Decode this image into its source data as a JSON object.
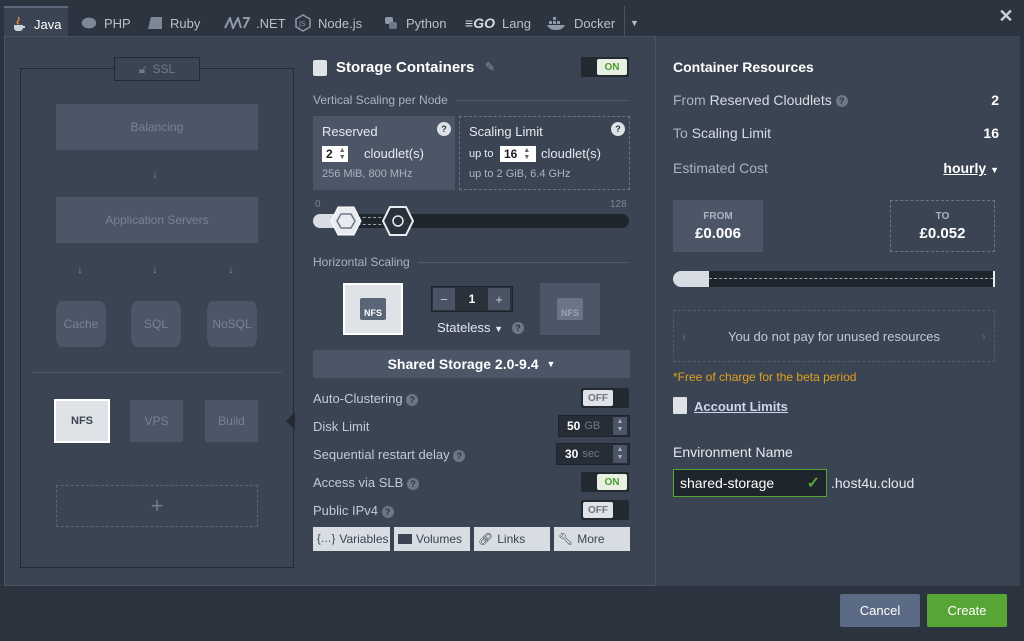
{
  "tabs": [
    {
      "label": "Java",
      "icon": "java-icon"
    },
    {
      "label": "PHP",
      "icon": "php-icon"
    },
    {
      "label": "Ruby",
      "icon": "ruby-icon"
    },
    {
      "label": ".NET",
      "icon": "dotnet-icon"
    },
    {
      "label": "Node.js",
      "icon": "nodejs-icon"
    },
    {
      "label": "Python",
      "icon": "python-icon"
    },
    {
      "label": "Lang",
      "icon": "go-icon",
      "prefix": "GO"
    },
    {
      "label": "Docker",
      "icon": "docker-icon"
    }
  ],
  "topology": {
    "ssl": "SSL",
    "balancing": "Balancing",
    "app_servers": "Application Servers",
    "cache": "Cache",
    "sql": "SQL",
    "nosql": "NoSQL",
    "nfs": "NFS",
    "vps": "VPS",
    "build": "Build",
    "add": "+"
  },
  "storage": {
    "title": "Storage Containers",
    "toggle": "ON",
    "vertical_scaling": "Vertical Scaling per Node",
    "reserved_label": "Reserved",
    "reserved_value": "2",
    "cloudlets": "cloudlet(s)",
    "reserved_spec": "256 MiB, 800 MHz",
    "limit_label": "Scaling Limit",
    "up_to": "up to",
    "limit_value": "16",
    "limit_spec": "up to 2 GiB, 6.4 GHz",
    "slider_min": "0",
    "slider_max": "128",
    "horizontal_scaling": "Horizontal Scaling",
    "node_label": "NFS",
    "node_count": "1",
    "stateless": "Stateless",
    "version": "Shared Storage 2.0-9.4",
    "auto_clustering": "Auto-Clustering",
    "auto_clustering_toggle": "OFF",
    "disk_limit": "Disk Limit",
    "disk_value": "50",
    "disk_unit": "GB",
    "restart_delay": "Sequential restart delay",
    "restart_value": "30",
    "restart_unit": "sec",
    "slb": "Access via SLB",
    "slb_toggle": "ON",
    "ipv4": "Public IPv4",
    "ipv4_toggle": "OFF",
    "buttons": {
      "variables": "Variables",
      "volumes": "Volumes",
      "links": "Links",
      "more": "More"
    }
  },
  "resources": {
    "title": "Container Resources",
    "from_label": "From",
    "from_rest": "Reserved Cloudlets",
    "from_value": "2",
    "to_label": "To",
    "to_rest": "Scaling Limit",
    "to_value": "16",
    "cost_label": "Estimated Cost",
    "cost_period": "hourly",
    "from_box_label": "FROM",
    "from_price": "£0.006",
    "to_box_label": "TO",
    "to_price": "£0.052",
    "unused_note": "You do not pay for unused resources",
    "beta_note": "*Free of charge for the beta period",
    "account_limits": "Account Limits",
    "env_name_label": "Environment Name",
    "env_name_value": "shared-storage",
    "domain_suffix": ".host4u.cloud"
  },
  "footer": {
    "cancel": "Cancel",
    "create": "Create"
  },
  "colors": {
    "create": "#57a535",
    "cancel": "#5c6b85",
    "on_green": "#4c9b32",
    "beta_orange": "#e0a020"
  }
}
